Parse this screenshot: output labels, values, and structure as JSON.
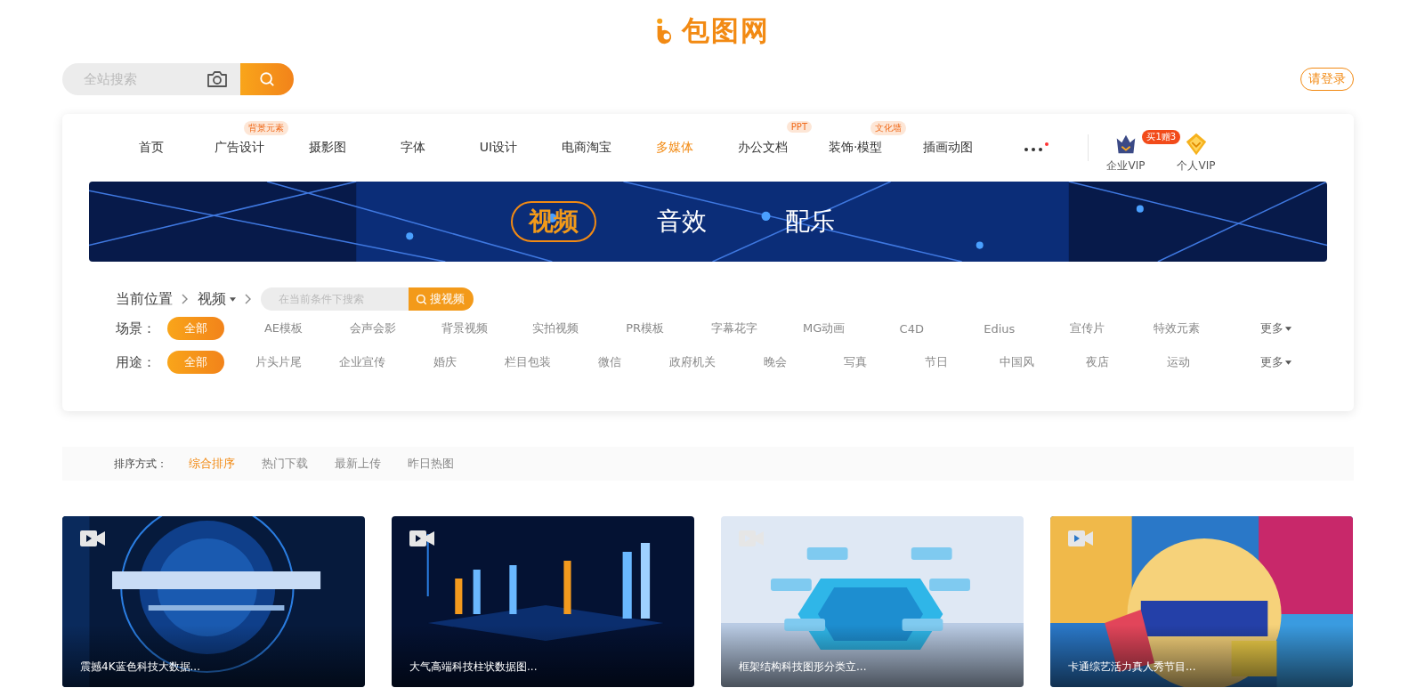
{
  "logo": {
    "text": "包图网"
  },
  "search": {
    "placeholder": "全站搜索"
  },
  "login": "请登录",
  "nav": {
    "items": [
      {
        "label": "首页",
        "selected": false
      },
      {
        "label": "广告设计",
        "badge": "背景元素",
        "selected": false
      },
      {
        "label": "摄影图",
        "selected": false
      },
      {
        "label": "字体",
        "selected": false
      },
      {
        "label": "UI设计",
        "selected": false
      },
      {
        "label": "电商淘宝",
        "selected": false
      },
      {
        "label": "多媒体",
        "selected": true
      },
      {
        "label": "办公文档",
        "badge": "PPT",
        "selected": false
      },
      {
        "label": "装饰·模型",
        "badge": "文化墙",
        "selected": false
      },
      {
        "label": "插画动图",
        "selected": false
      }
    ],
    "vip": [
      {
        "label": "企业VIP",
        "badge": "买1赠3",
        "kind": "enterprise"
      },
      {
        "label": "个人VIP",
        "kind": "personal"
      }
    ]
  },
  "banner_tabs": [
    {
      "label": "视频",
      "selected": true
    },
    {
      "label": "音效",
      "selected": false
    },
    {
      "label": "配乐",
      "selected": false
    }
  ],
  "breadcrumb": {
    "label": "当前位置",
    "current": "视频",
    "placeholder": "在当前条件下搜索",
    "button": "搜视频"
  },
  "filters": [
    {
      "label": "场景：",
      "options": [
        {
          "label": "全部",
          "selected": true
        },
        {
          "label": "AE模板",
          "selected": false
        },
        {
          "label": "会声会影",
          "selected": false
        },
        {
          "label": "背景视频",
          "selected": false
        },
        {
          "label": "实拍视频",
          "selected": false
        },
        {
          "label": "PR模板",
          "selected": false
        },
        {
          "label": "字幕花字",
          "selected": false
        },
        {
          "label": "MG动画",
          "selected": false
        },
        {
          "label": "C4D",
          "selected": false
        },
        {
          "label": "Edius",
          "selected": false
        },
        {
          "label": "宣传片",
          "selected": false
        },
        {
          "label": "特效元素",
          "selected": false
        }
      ],
      "more": "更多"
    },
    {
      "label": "用途：",
      "options": [
        {
          "label": "全部",
          "selected": true
        },
        {
          "label": "片头片尾",
          "selected": false
        },
        {
          "label": "企业宣传",
          "selected": false
        },
        {
          "label": "婚庆",
          "selected": false
        },
        {
          "label": "栏目包装",
          "selected": false
        },
        {
          "label": "微信",
          "selected": false
        },
        {
          "label": "政府机关",
          "selected": false
        },
        {
          "label": "晚会",
          "selected": false
        },
        {
          "label": "写真",
          "selected": false
        },
        {
          "label": "节日",
          "selected": false
        },
        {
          "label": "中国风",
          "selected": false
        },
        {
          "label": "夜店",
          "selected": false
        },
        {
          "label": "运动",
          "selected": false
        }
      ],
      "more": "更多"
    }
  ],
  "sort": {
    "label": "排序方式：",
    "options": [
      {
        "label": "综合排序",
        "selected": true
      },
      {
        "label": "热门下载",
        "selected": false
      },
      {
        "label": "最新上传",
        "selected": false
      },
      {
        "label": "昨日热图",
        "selected": false
      }
    ]
  },
  "cards": [
    {
      "title": "震撼4K蓝色科技大数据..."
    },
    {
      "title": "大气高端科技柱状数据图..."
    },
    {
      "title": "框架结构科技图形分类立..."
    },
    {
      "title": "卡通综艺活力真人秀节目..."
    }
  ]
}
